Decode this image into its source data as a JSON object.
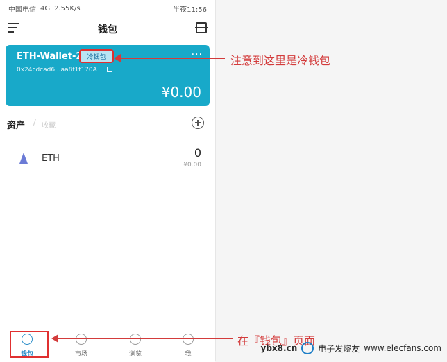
{
  "status_bar": {
    "carrier": "中国电信",
    "network": "4G",
    "speed": "2.55K/s",
    "time": "半夜11:56"
  },
  "header": {
    "title": "钱包"
  },
  "wallet_card": {
    "name": "ETH-Wallet-2",
    "badge": "冷钱包",
    "more": "···",
    "address": "0x24cdcad6...aa8f1f170A",
    "balance": "¥0.00",
    "color": "#18a9c9"
  },
  "assets": {
    "title": "资产",
    "separator": "/",
    "favorites": "收藏",
    "items": [
      {
        "symbol": "ETH",
        "amount": "0",
        "value": "¥0.00",
        "icon": "eth-icon"
      }
    ]
  },
  "bottom_nav": {
    "items": [
      {
        "label": "钱包",
        "icon": "wallet-icon",
        "active": true
      },
      {
        "label": "市场",
        "icon": "chart-icon",
        "active": false
      },
      {
        "label": "浏览",
        "icon": "browse-icon",
        "active": false
      },
      {
        "label": "我",
        "icon": "profile-icon",
        "active": false
      }
    ]
  },
  "annotations": {
    "top": "注意到这里是冷钱包",
    "bottom": "在『钱包』页面"
  },
  "watermark": {
    "site": "ybx8.cn",
    "brand": "电子发烧友",
    "domain": "www.elecfans.com"
  }
}
